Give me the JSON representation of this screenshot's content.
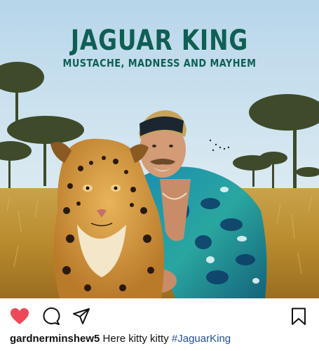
{
  "post": {
    "poster_title": "JAGUAR KING",
    "poster_subtitle": "MUSTACHE, MADNESS AND MAYHEM"
  },
  "actions": {
    "like_icon": "heart-icon",
    "comment_icon": "comment-icon",
    "share_icon": "paper-plane-icon",
    "save_icon": "bookmark-icon",
    "like_color": "#ed4956",
    "liked": true
  },
  "caption": {
    "username": "gardnerminshew5",
    "text": "Here kitty kitty",
    "hashtag": "#JaguarKing"
  },
  "colors": {
    "title_teal": "#0f5f55",
    "hashtag_blue": "#1f4e9c"
  }
}
